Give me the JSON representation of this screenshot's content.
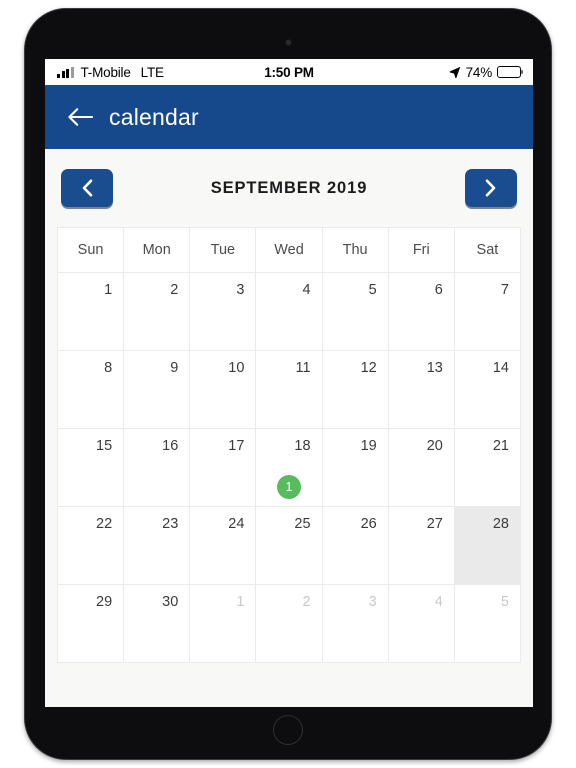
{
  "status_bar": {
    "carrier": "T-Mobile",
    "network": "LTE",
    "time": "1:50 PM",
    "battery_percent": "74%",
    "signal_icon": "signal-bars-icon",
    "location_icon": "location-arrow-icon",
    "battery_icon": "battery-icon"
  },
  "nav_bar": {
    "back_icon": "back-arrow-icon",
    "title": "calendar",
    "background_color": "#16498c"
  },
  "calendar": {
    "prev_label": "‹",
    "next_label": "›",
    "prev_icon": "chevron-left-icon",
    "next_icon": "chevron-right-icon",
    "month_title": "SEPTEMBER 2019",
    "accent_color": "#1a4d8f",
    "event_color": "#58bb5d",
    "selected_color": "#eaeaea",
    "weekdays": [
      "Sun",
      "Mon",
      "Tue",
      "Wed",
      "Thu",
      "Fri",
      "Sat"
    ],
    "weeks": [
      [
        {
          "day": "",
          "other_month": false,
          "selected": false,
          "badge": ""
        },
        {
          "day": "1",
          "other_month": false,
          "selected": false,
          "badge": ""
        },
        {
          "day": "2",
          "other_month": false,
          "selected": false,
          "badge": ""
        },
        {
          "day": "3",
          "other_month": false,
          "selected": false,
          "badge": ""
        },
        {
          "day": "4",
          "other_month": false,
          "selected": false,
          "badge": ""
        },
        {
          "day": "5",
          "other_month": false,
          "selected": false,
          "badge": ""
        },
        {
          "day": "6",
          "other_month": false,
          "selected": false,
          "badge": ""
        },
        {
          "day": "7",
          "other_month": false,
          "selected": false,
          "badge": ""
        }
      ],
      [
        {
          "day": "8",
          "other_month": false,
          "selected": false,
          "badge": ""
        },
        {
          "day": "9",
          "other_month": false,
          "selected": false,
          "badge": ""
        },
        {
          "day": "10",
          "other_month": false,
          "selected": false,
          "badge": ""
        },
        {
          "day": "11",
          "other_month": false,
          "selected": false,
          "badge": ""
        },
        {
          "day": "12",
          "other_month": false,
          "selected": false,
          "badge": ""
        },
        {
          "day": "13",
          "other_month": false,
          "selected": false,
          "badge": ""
        },
        {
          "day": "14",
          "other_month": false,
          "selected": false,
          "badge": ""
        }
      ],
      [
        {
          "day": "15",
          "other_month": false,
          "selected": false,
          "badge": ""
        },
        {
          "day": "16",
          "other_month": false,
          "selected": false,
          "badge": ""
        },
        {
          "day": "17",
          "other_month": false,
          "selected": false,
          "badge": ""
        },
        {
          "day": "18",
          "other_month": false,
          "selected": false,
          "badge": "1"
        },
        {
          "day": "19",
          "other_month": false,
          "selected": false,
          "badge": ""
        },
        {
          "day": "20",
          "other_month": false,
          "selected": false,
          "badge": ""
        },
        {
          "day": "21",
          "other_month": false,
          "selected": false,
          "badge": ""
        }
      ],
      [
        {
          "day": "22",
          "other_month": false,
          "selected": false,
          "badge": ""
        },
        {
          "day": "23",
          "other_month": false,
          "selected": false,
          "badge": ""
        },
        {
          "day": "24",
          "other_month": false,
          "selected": false,
          "badge": ""
        },
        {
          "day": "25",
          "other_month": false,
          "selected": false,
          "badge": ""
        },
        {
          "day": "26",
          "other_month": false,
          "selected": false,
          "badge": ""
        },
        {
          "day": "27",
          "other_month": false,
          "selected": false,
          "badge": ""
        },
        {
          "day": "28",
          "other_month": false,
          "selected": true,
          "badge": ""
        }
      ],
      [
        {
          "day": "29",
          "other_month": false,
          "selected": false,
          "badge": ""
        },
        {
          "day": "30",
          "other_month": false,
          "selected": false,
          "badge": ""
        },
        {
          "day": "1",
          "other_month": true,
          "selected": false,
          "badge": ""
        },
        {
          "day": "2",
          "other_month": true,
          "selected": false,
          "badge": ""
        },
        {
          "day": "3",
          "other_month": true,
          "selected": false,
          "badge": ""
        },
        {
          "day": "4",
          "other_month": true,
          "selected": false,
          "badge": ""
        },
        {
          "day": "5",
          "other_month": true,
          "selected": false,
          "badge": ""
        }
      ]
    ]
  }
}
